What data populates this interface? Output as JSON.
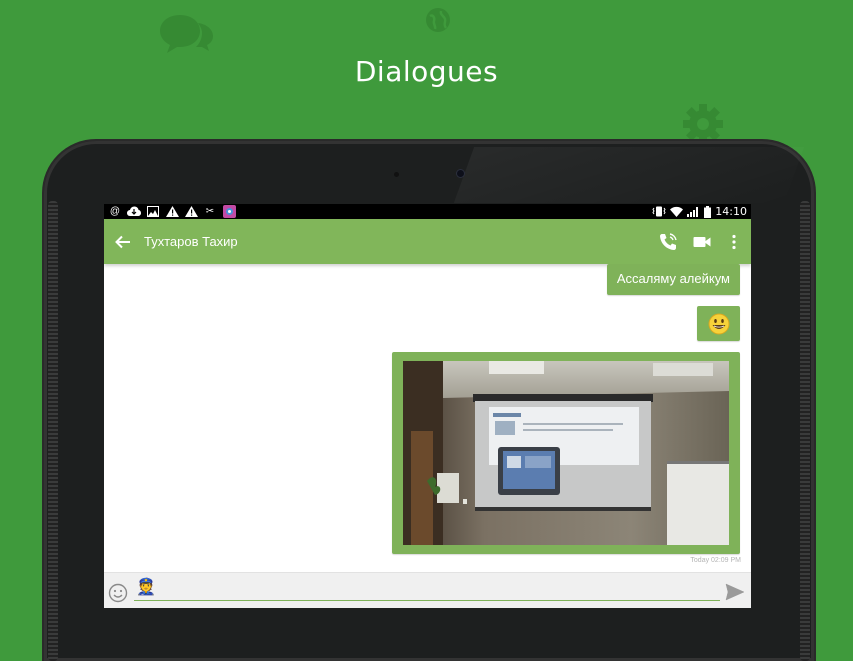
{
  "headline": "Dialogues",
  "background_icons": [
    "chat-bubbles-icon",
    "globe-icon",
    "gear-icon"
  ],
  "status_bar": {
    "time": "14:10",
    "left_icons": [
      "at-sign-icon",
      "cloud-download-icon",
      "image-icon",
      "warning-icon",
      "warning-icon",
      "scissors-icon",
      "app-notification-icon"
    ],
    "right_icons": [
      "vibrate-icon",
      "wifi-icon",
      "signal-icon",
      "battery-icon"
    ]
  },
  "app_bar": {
    "contact_name": "Тухтаров Тахир",
    "actions": [
      "phone-call-icon",
      "video-call-icon",
      "more-vert-icon"
    ]
  },
  "messages": [
    {
      "type": "text",
      "text": "Ассаляму алейкум"
    },
    {
      "type": "emoji",
      "text": "😃"
    },
    {
      "type": "image",
      "description": "projector-presentation-photo"
    }
  ],
  "timestamp": "Today 02:09 PM",
  "composer": {
    "value": "",
    "sticker_emoji": "👮"
  },
  "colors": {
    "background": "#3f9a3c",
    "app_bar": "#81b65a",
    "bubble": "#7fb259"
  }
}
